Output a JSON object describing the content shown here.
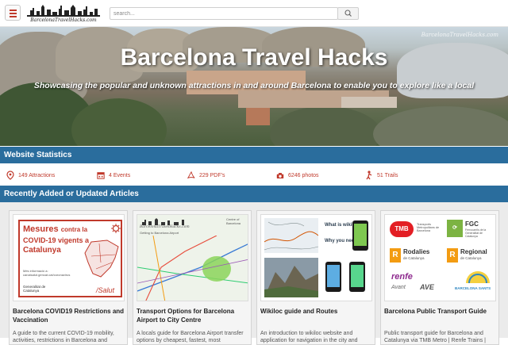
{
  "header": {
    "logo_text": "BarcelonaTravelHacks.com",
    "search_placeholder": "search..."
  },
  "hero": {
    "title": "Barcelona Travel Hacks",
    "subtitle": "Showcasing the popular and unknown attractions in and around Barcelona to enable you to explore like a local",
    "watermark": "BarcelonaTravelHacks.com"
  },
  "stats": {
    "heading": "Website Statistics",
    "items": [
      {
        "label": "149 Attractions",
        "icon": "map-pin-icon"
      },
      {
        "label": "4 Events",
        "icon": "calendar-icon"
      },
      {
        "label": "229 PDF's",
        "icon": "pdf-icon"
      },
      {
        "label": "6246 photos",
        "icon": "camera-icon"
      },
      {
        "label": "51 Trails",
        "icon": "hiker-icon"
      }
    ]
  },
  "articles": {
    "heading": "Recently Added or Updated Articles",
    "cards": [
      {
        "title": "Barcelona COVID19 Restrictions and Vaccination",
        "desc": "A guide to the current COVID-19 mobility, activities, restrictions in Barcelona and",
        "thumb": {
          "line1": "Mesures",
          "line1b": "contra la",
          "line2": "COVID-19 vigents a",
          "line3": "Catalunya",
          "small": "Més informació a: canalsalut.gencat.cat/coronavirus",
          "footer_left": "Generalitat de Catalunya",
          "footer_right": "/Salut"
        }
      },
      {
        "title": "Transport Options for Barcelona Airport to City Centre",
        "desc": "A locals guide for Barcelona Airport transfer options by cheapest, fastest, most",
        "thumb": {
          "caption": "BarcelonaTravelHacks.com",
          "sub": "Getting to Barcelona Airport",
          "side": "Centre of Barcelona"
        }
      },
      {
        "title": "Wikiloc guide and Routes",
        "desc": "An introduction to wikiloc website and application for navigation in the city and",
        "thumb": {
          "q1": "What is wikiloc",
          "q2": "Why you need it."
        }
      },
      {
        "title": "Barcelona Public Transport Guide",
        "desc": "Public transport guide for Barcelona and Catalunya via TMB Metro | Renfe Trains |",
        "thumb": {
          "tmb": "TMB",
          "tmb_sub": "Transports Metropolitans de Barcelona",
          "fgc": "FGC",
          "fgc_sub": "Ferrocarrils de la Generalitat de Catalunya",
          "rodalies": "Rodalies",
          "rodalies_sub": "de Catalunya",
          "regional": "Regional",
          "regional_sub": "de Catalunya",
          "renfe": "renfe",
          "avant": "Avant",
          "ave": "AVE",
          "sants": "BARCELONA SANTS"
        }
      }
    ]
  },
  "colors": {
    "accent": "#c0392b",
    "bar": "#2a6d9d"
  }
}
